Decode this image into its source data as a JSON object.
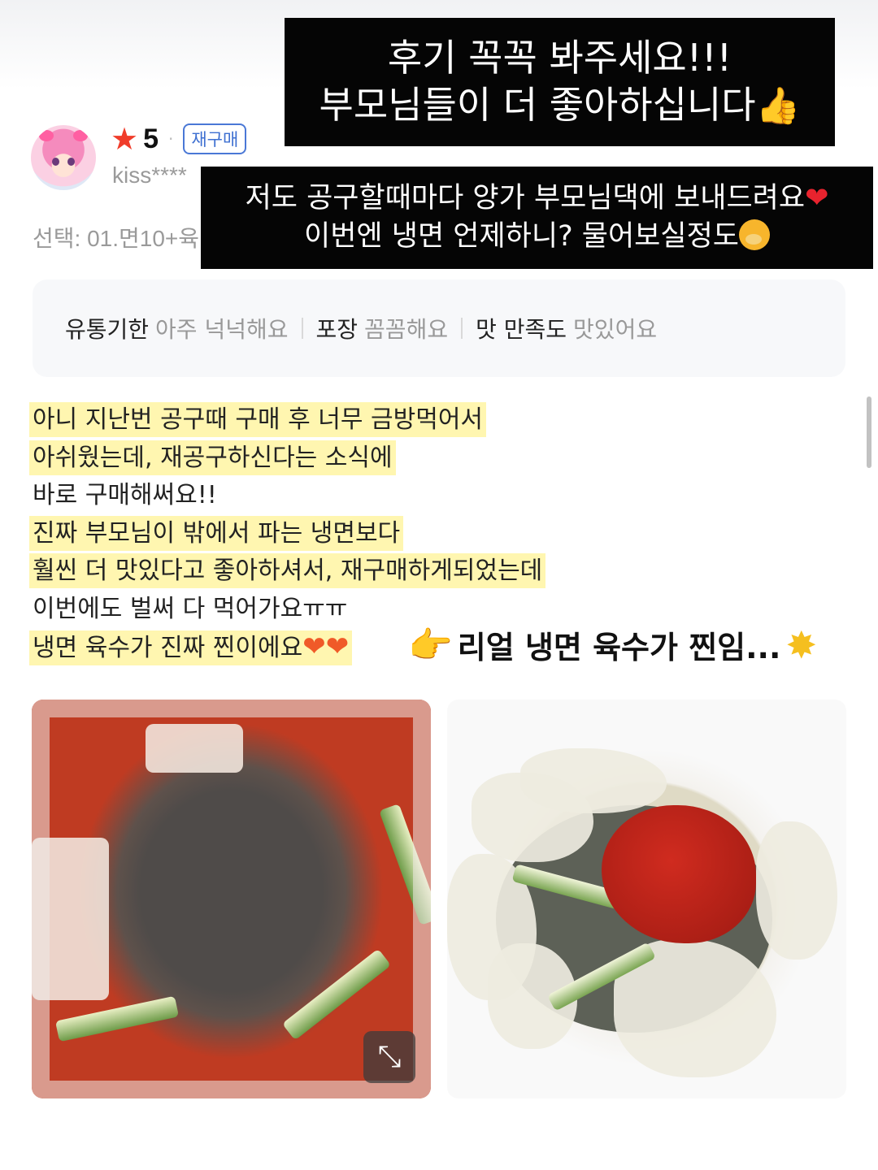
{
  "captions": {
    "top_line1": "후기 꼭꼭 봐주세요!!!",
    "top_line2": "부모님들이 더 좋아하십니다",
    "mid_line1": "저도 공구할때마다 양가 부모님댁에 보내드려요",
    "mid_line2": "이번엔 냉면 언제하니? 물어보실정도",
    "heart_glyph": "❤",
    "thumb_glyph": "👍"
  },
  "review": {
    "rating_star": "★",
    "rating": "5",
    "dot": "·",
    "rebuy_badge": "재구매",
    "username": "kiss****",
    "option": "선택: 01.면10+육",
    "tags": [
      {
        "key": "유통기한",
        "value": "아주 넉넉해요"
      },
      {
        "key": "포장",
        "value": "꼼꼼해요"
      },
      {
        "key": "맛 만족도",
        "value": "맛있어요"
      }
    ],
    "body_lines": [
      "아니 지난번 공구때 구매 후 너무 금방먹어서",
      "아쉬웠는데, 재공구하신다는 소식에",
      "바로 구매해써요!!",
      "진짜 부모님이 밖에서 파는 냉면보다",
      "훨씬 더 맛있다고 좋아하셔서, 재구매하게되었는데",
      "이번에도 벌써 다 먹어가요ㅠㅠ",
      "냉면 육수가 진짜 찐이에요"
    ],
    "hearts": "❤❤"
  },
  "annotation": {
    "pointer_glyph": "👉",
    "text": "리얼 냉면 육수가 찐임...",
    "star_glyph": "✸"
  },
  "photos": {
    "expand_glyph": "⤡"
  }
}
